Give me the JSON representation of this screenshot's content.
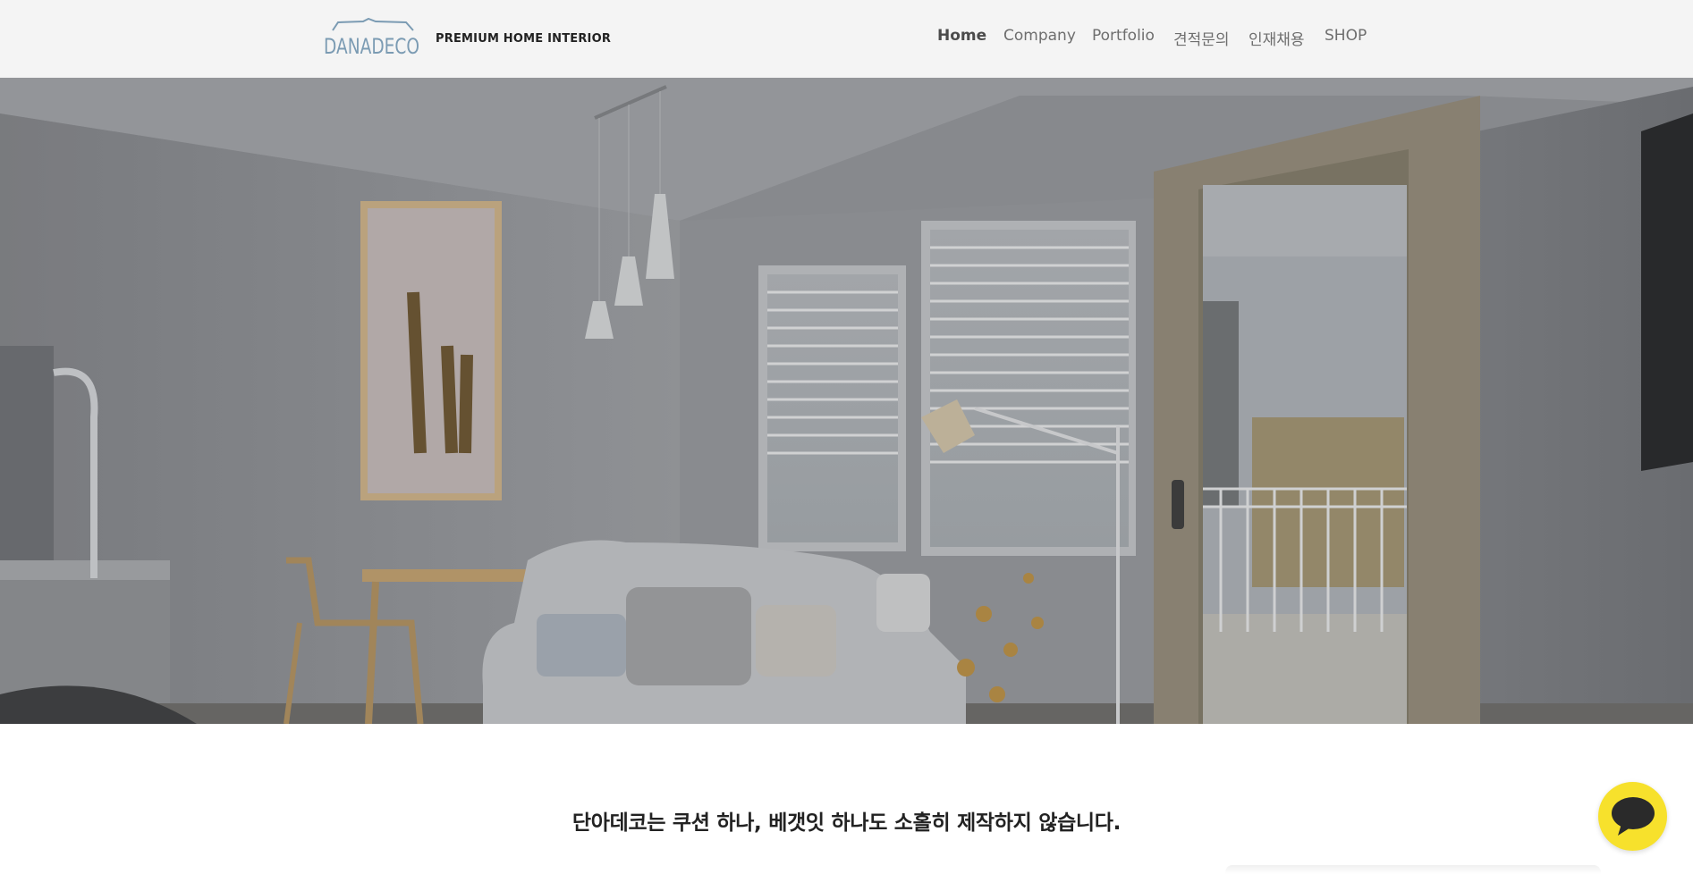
{
  "brand": {
    "logo_text": "DANADECO",
    "tagline": "PREMIUM HOME INTERIOR"
  },
  "nav": {
    "items": [
      {
        "label": "Home",
        "active": true
      },
      {
        "label": "Company",
        "active": false
      },
      {
        "label": "Portfolio",
        "active": false
      },
      {
        "label": "견적문의",
        "active": false
      },
      {
        "label": "인재채용",
        "active": false
      },
      {
        "label": "SHOP",
        "active": false
      }
    ]
  },
  "hero": {
    "image": "living-room-interior-photo"
  },
  "main": {
    "headline": "단아데코는 쿠션 하나, 베갯잇 하나도 소홀히 제작하지 않습니다."
  },
  "chat": {
    "icon": "chat-bubble-icon",
    "color": "#f7e12c"
  },
  "colors": {
    "header_bg": "#f4f4f4",
    "logo_color": "#7b9bb3",
    "nav_text": "#6e6e6e",
    "nav_active": "#4b4b4b"
  }
}
